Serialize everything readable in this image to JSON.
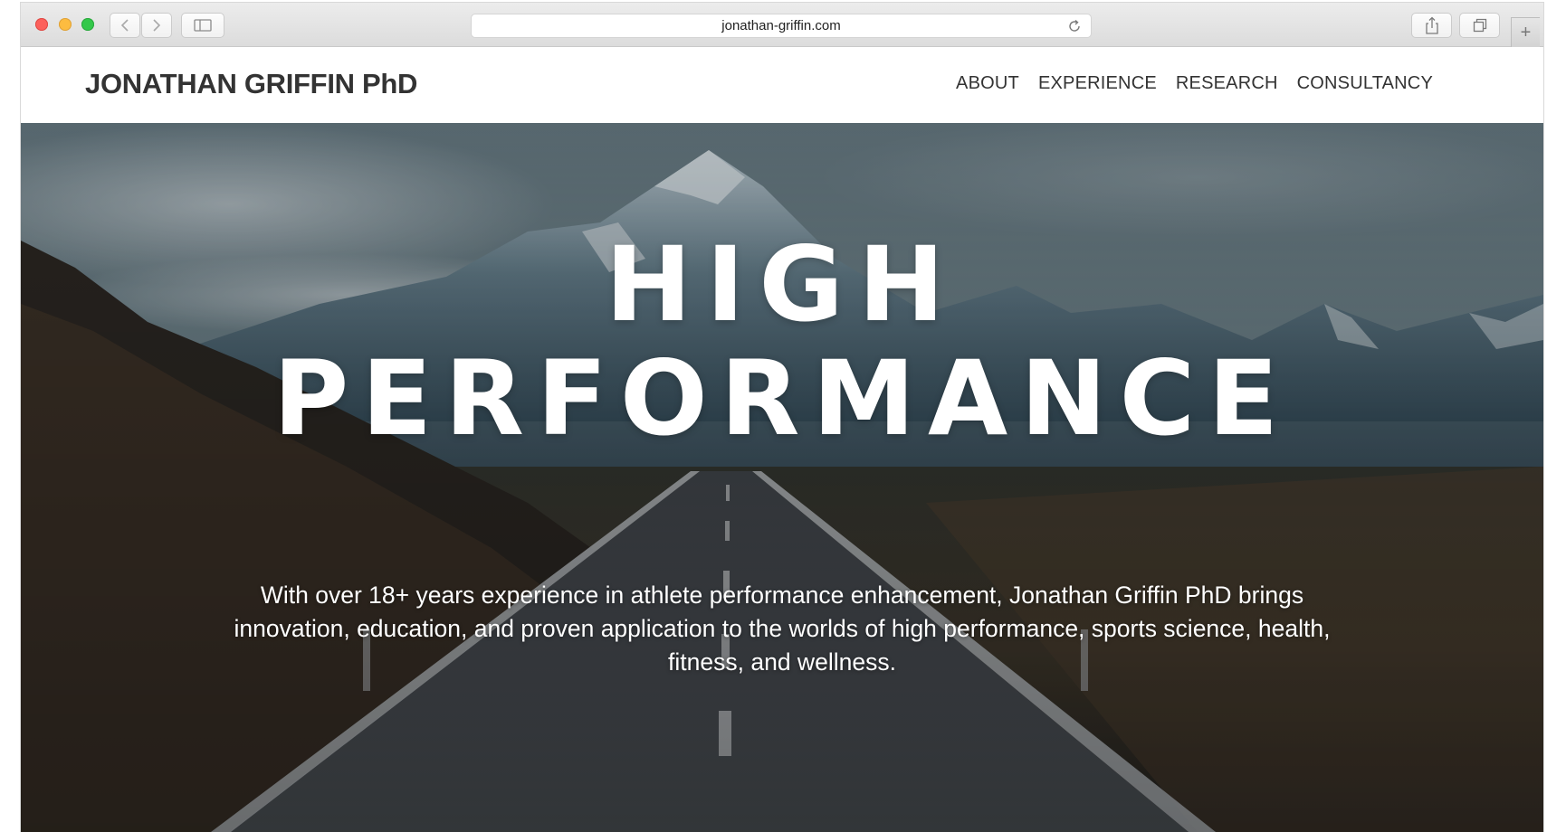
{
  "browser": {
    "url": "jonathan-griffin.com",
    "icons": {
      "back": "chevron-left-icon",
      "forward": "chevron-right-icon",
      "sidebar": "sidebar-icon",
      "reload": "reload-icon",
      "share": "share-icon",
      "tabs": "tabs-icon",
      "new_tab": "plus-icon"
    },
    "new_tab_label": "+"
  },
  "site": {
    "logo": "JONATHAN GRIFFIN PhD",
    "nav": [
      "ABOUT",
      "EXPERIENCE",
      "RESEARCH",
      "CONSULTANCY"
    ]
  },
  "hero": {
    "title_line1": "HIGH",
    "title_line2": "PERFORMANCE",
    "description": "With over 18+ years experience in athlete performance enhancement, Jonathan Griffin PhD brings innovation, education, and proven application to the worlds of high performance, sports science, health, fitness, and wellness.",
    "background": "mountain-road-image"
  },
  "colors": {
    "header_text": "#333333",
    "hero_text": "#ffffff",
    "close": "#fc605b",
    "minimize": "#fdbc40",
    "zoom": "#34c84a"
  }
}
